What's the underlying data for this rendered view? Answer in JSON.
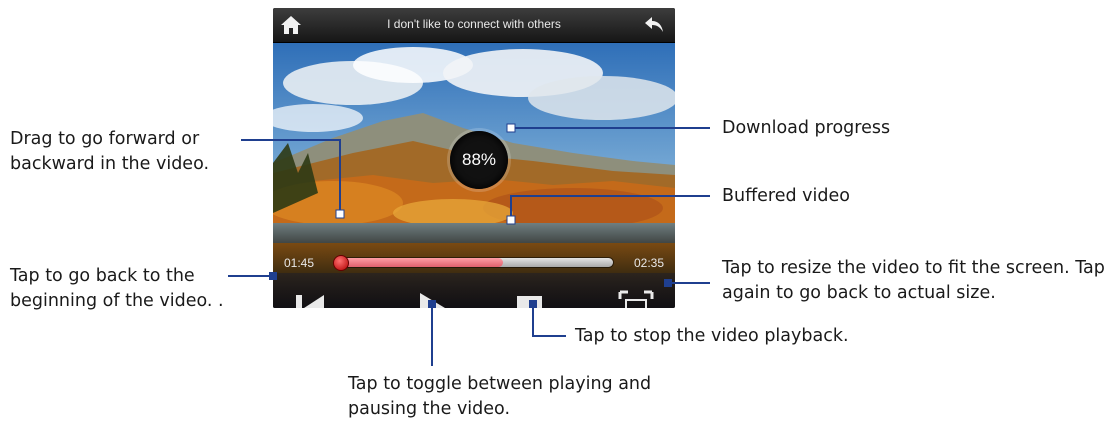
{
  "player": {
    "title": "I don't like to connect with others",
    "download_progress": "88%",
    "time_elapsed": "01:45",
    "time_total": "02:35",
    "buffered_fraction": 0.6,
    "playhead_fraction": 0.0
  },
  "icons": {
    "home": "home-icon",
    "back": "back-arrow-icon",
    "previous": "skip-to-start-icon",
    "play": "play-icon",
    "stop": "stop-icon",
    "fit": "resize-fit-icon"
  },
  "callouts": {
    "drag": "Drag to go forward or backward in the video.",
    "beginning": "Tap to go back to the beginning of the video. .",
    "download": "Download progress",
    "buffered": "Buffered video",
    "resize": "Tap to resize the video to fit the screen. Tap again to go back to actual size.",
    "stop": "Tap to stop the video playback.",
    "toggle": "Tap to toggle between playing and pausing the video."
  },
  "colors": {
    "leader_line": "#1f3f8f",
    "buffered_bar": "#f07882",
    "track": "#c8c8c8"
  }
}
